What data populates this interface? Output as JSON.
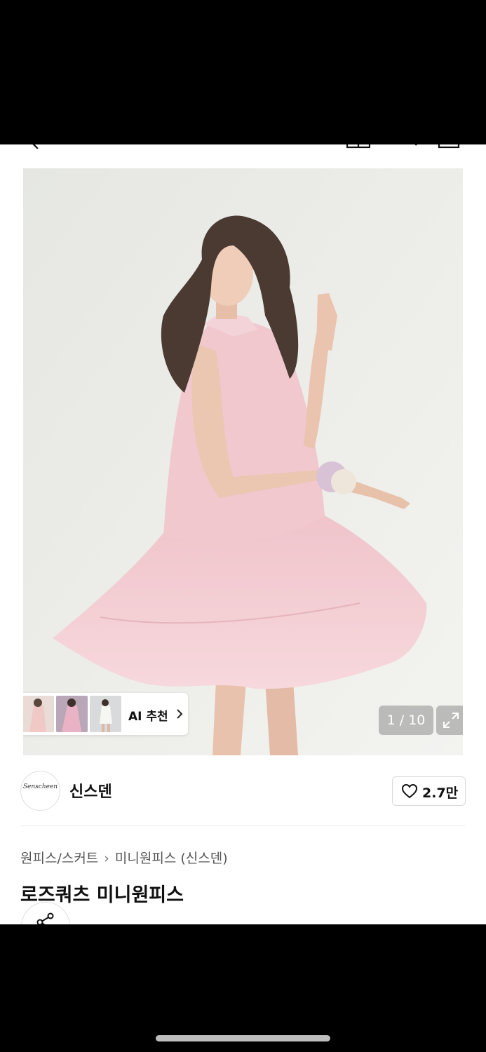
{
  "header": {
    "icons": [
      "back-icon",
      "grid-icon",
      "search-icon",
      "cart-icon"
    ]
  },
  "gallery": {
    "counter": "1 / 10",
    "ai_recommend": {
      "label": "AI 추천"
    },
    "colors": {
      "background": "#e8e9e5",
      "dress": "#f2c9cf",
      "hair": "#4a3a32",
      "skin": "#e9c7b2"
    }
  },
  "brand": {
    "logo_text": "Senscheen",
    "name": "신스덴",
    "likes": "2.7만"
  },
  "breadcrumb": {
    "category": "원피스/스커트",
    "subcategory": "미니원피스 (신스덴)"
  },
  "product": {
    "title": "로즈쿼츠 미니원피스"
  }
}
